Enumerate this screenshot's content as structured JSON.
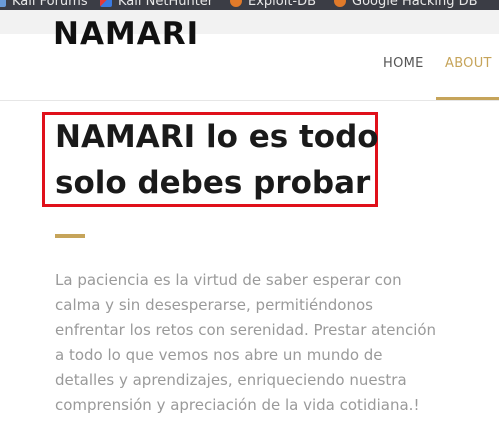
{
  "bookmarks": [
    {
      "label": "Kali Forums",
      "icon": "kali-icon"
    },
    {
      "label": "Kali NetHunter",
      "icon": "nethunter-icon"
    },
    {
      "label": "Exploit-DB",
      "icon": "exploit-db-icon"
    },
    {
      "label": "Google Hacking DB",
      "icon": "google-hacking-db-icon"
    }
  ],
  "header": {
    "logo": "NAMARI",
    "nav": {
      "home": "HOME",
      "about": "ABOUT"
    }
  },
  "main": {
    "title": "NAMARI lo es todo solo debes probar",
    "paragraph": "La paciencia es la virtud de saber esperar con calma y sin desesperarse, permitiéndonos enfrentar los retos con serenidad. Prestar atención a todo lo que vemos nos abre un mundo de detalles y aprendizajes, enriqueciendo nuestra comprensión y apreciación de la vida cotidiana.!"
  },
  "colors": {
    "accent": "#c6a45a",
    "highlight_box": "#e0101a",
    "bookmarks_bar": "#3b3d45",
    "body_text": "#9a9a9a"
  }
}
